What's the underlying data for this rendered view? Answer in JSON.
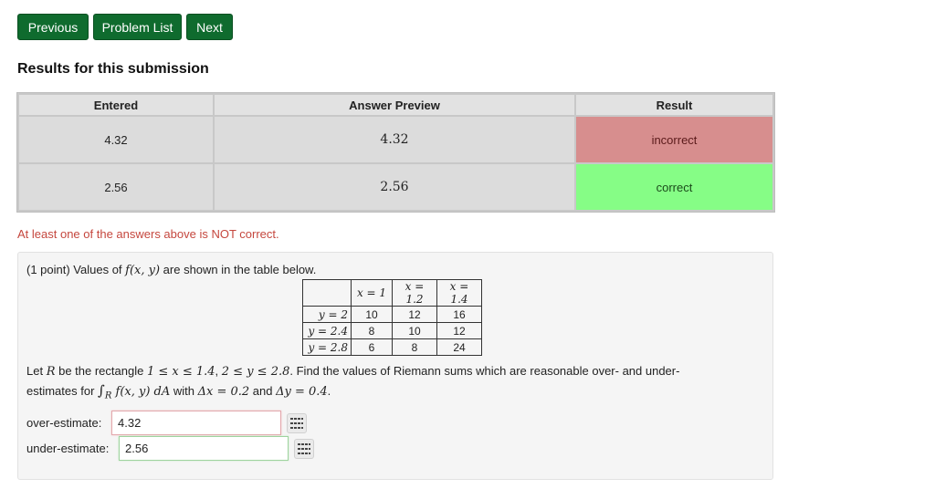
{
  "nav": {
    "previous_label": "Previous",
    "problem_list_label": "Problem List",
    "next_label": "Next"
  },
  "results": {
    "heading": "Results for this submission",
    "headers": [
      "Entered",
      "Answer Preview",
      "Result"
    ],
    "rows": [
      {
        "entered": "4.32",
        "preview": "4.32",
        "result": "incorrect"
      },
      {
        "entered": "2.56",
        "preview": "2.56",
        "result": "correct"
      }
    ],
    "warning": "At least one of the answers above is NOT correct."
  },
  "problem": {
    "intro_prefix": "(1 point) Values of ",
    "intro_func": "f(x, y)",
    "intro_suffix": " are shown in the table below.",
    "table": {
      "header": [
        "",
        "x = 1",
        "x = 1.2",
        "x = 1.4"
      ],
      "rows": [
        [
          "y = 2",
          "10",
          "12",
          "16"
        ],
        [
          "y = 2.4",
          "8",
          "10",
          "12"
        ],
        [
          "y = 2.8",
          "6",
          "8",
          "24"
        ]
      ]
    },
    "text_let": "Let ",
    "text_R": "R",
    "text_rect": " be the rectangle ",
    "text_xrange": "1 ≤ x ≤ 1.4",
    "text_comma": ", ",
    "text_yrange": "2 ≤ y ≤ 2.8",
    "text_find": ". Find the values of Riemann sums which are reasonable over- and under-",
    "text_estimates": "estimates for ",
    "text_integral": "∫",
    "text_sub": "R",
    "text_integrand": " f(x, y) dA",
    "text_with": " with ",
    "text_dx": "Δx = 0.2",
    "text_and": " and ",
    "text_dy": "Δy = 0.4",
    "text_period": ".",
    "over_label": "over-estimate:",
    "over_value": "4.32",
    "under_label": "under-estimate:",
    "under_value": "2.56"
  },
  "colors": {
    "nav_button": "#0f6b2e",
    "incorrect_bg": "#d78e8e",
    "correct_bg": "#86fd86",
    "warning_text": "#c5473e"
  },
  "icons": {
    "answer_grid": "equation-grid-icon"
  }
}
